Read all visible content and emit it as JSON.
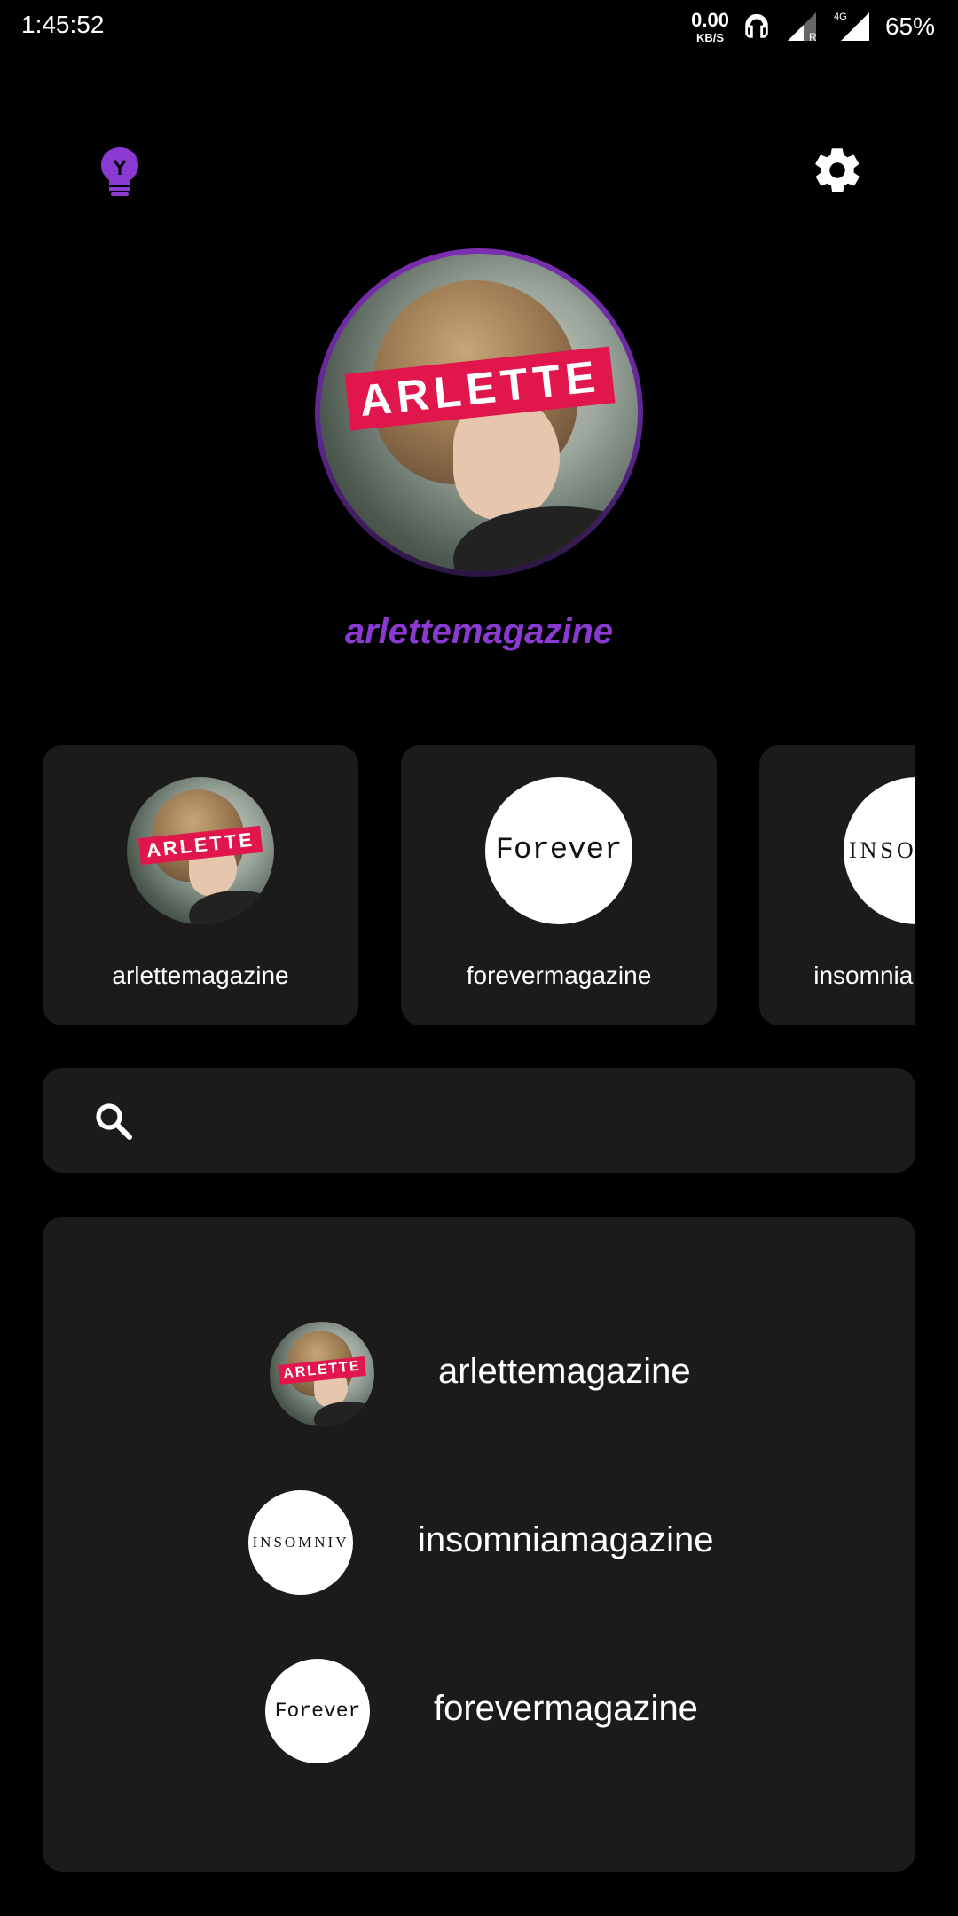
{
  "status_bar": {
    "time": "1:45:52",
    "net_speed_value": "0.00",
    "net_speed_unit": "KB/S",
    "signal_1_badge": "R",
    "signal_2_badge": "4G",
    "battery": "65%"
  },
  "header": {
    "left_icon": "lightbulb-icon",
    "right_icon": "gear-icon"
  },
  "profile": {
    "name": "arlettemagazine",
    "brand_tag": "ARLETTE"
  },
  "carousel": {
    "cards": [
      {
        "label": "arlettemagazine",
        "avatar_text": "ARLETTE"
      },
      {
        "label": "forevermagazine",
        "avatar_text": "Forever"
      },
      {
        "label": "insomniamagazine",
        "avatar_text": "INSOMNIA"
      }
    ]
  },
  "search": {
    "placeholder": "",
    "value": ""
  },
  "list": {
    "items": [
      {
        "label": "arlettemagazine",
        "avatar_text": "ARLETTE"
      },
      {
        "label": "insomniamagazine",
        "avatar_text": "INSOMNIV"
      },
      {
        "label": "forevermagazine",
        "avatar_text": "Forever"
      }
    ]
  },
  "colors": {
    "accent_purple": "#8a3ad0",
    "brand_red": "#e0164d",
    "card_bg": "#1b1b1b",
    "background": "#000000"
  }
}
